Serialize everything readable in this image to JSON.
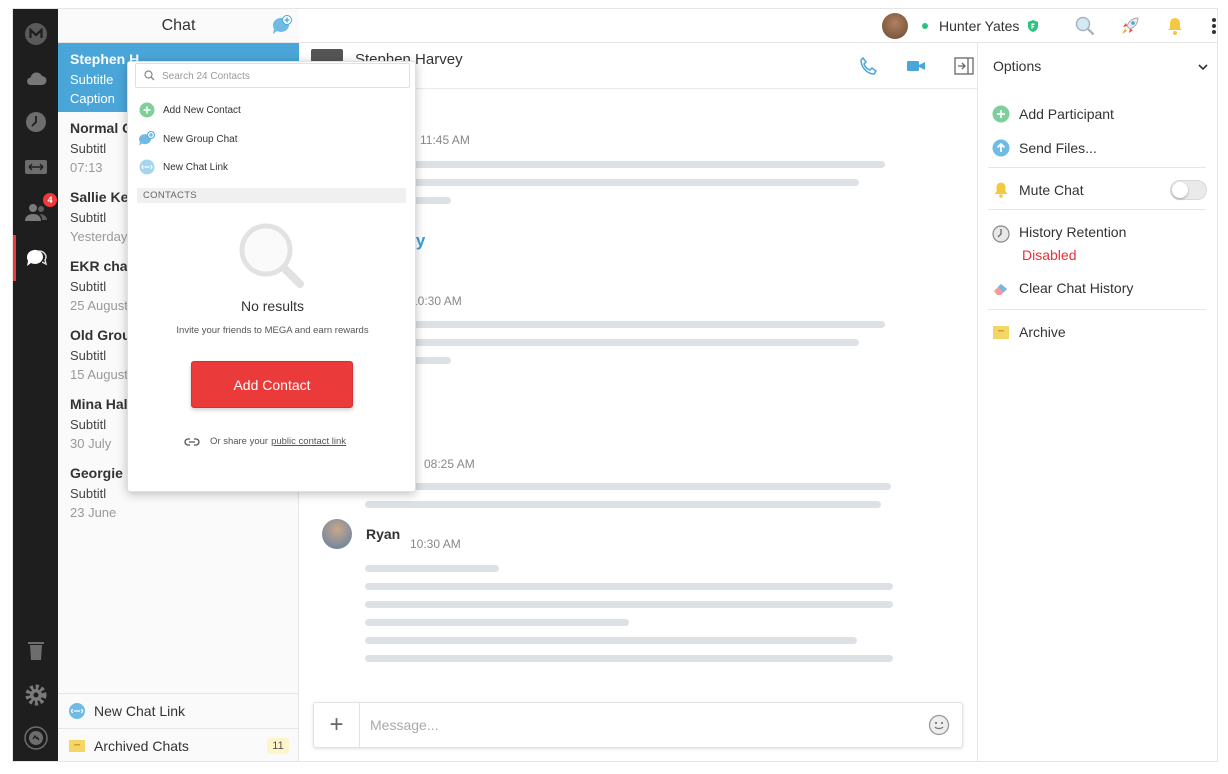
{
  "sidebar": {
    "badge_count": "4"
  },
  "chat_list": {
    "title": "Chat",
    "items": [
      {
        "name": "Stephen H",
        "subtitle": "Subtitle",
        "caption": "Caption"
      },
      {
        "name": "Normal C",
        "subtitle": "Subtitl",
        "caption": "07:13"
      },
      {
        "name": "Sallie Kel",
        "subtitle": "Subtitl",
        "caption": "Yesterday"
      },
      {
        "name": "EKR chat",
        "subtitle": "Subtitl",
        "caption": "25 August"
      },
      {
        "name": "Old Grou",
        "subtitle": "Subtitl",
        "caption": "15 August"
      },
      {
        "name": "Mina Hal",
        "subtitle": "Subtitl",
        "caption": "30 July"
      },
      {
        "name": "Georgie N",
        "subtitle": "Subtitl",
        "caption": "23 June"
      }
    ],
    "footer_new_link": "New Chat Link",
    "footer_archived": "Archived Chats",
    "archived_count": "11"
  },
  "topbar": {
    "user_name": "Hunter Yates"
  },
  "conversation": {
    "title": "Stephen Harvey",
    "times": [
      "11:45 AM",
      "10:30 AM",
      "08:25 AM",
      "10:30 AM"
    ],
    "day_label": "day",
    "last_sender": "Ryan",
    "composer_placeholder": "Message..."
  },
  "right_panel": {
    "header": "Options",
    "add_participant": "Add Participant",
    "send_files": "Send Files...",
    "mute_chat": "Mute Chat",
    "mute_on": false,
    "history_retention": "History Retention",
    "history_status": "Disabled",
    "clear_history": "Clear Chat History",
    "archive": "Archive"
  },
  "popover": {
    "search_placeholder": "Search 24 Contacts",
    "add_new_contact": "Add New Contact",
    "new_group_chat": "New Group Chat",
    "new_chat_link": "New Chat Link",
    "section_label": "CONTACTS",
    "no_results": "No results",
    "invite_text": "Invite your friends to MEGA and earn rewards",
    "add_contact_button": "Add Contact",
    "share_prefix": "Or share your",
    "share_link": "public contact link"
  },
  "colors": {
    "accent_blue": "#4aa6d9",
    "mega_red": "#eb3a3a",
    "rail_bg": "#1e1e1e",
    "green": "#2cc37c",
    "disabled_red": "#e0343a"
  }
}
